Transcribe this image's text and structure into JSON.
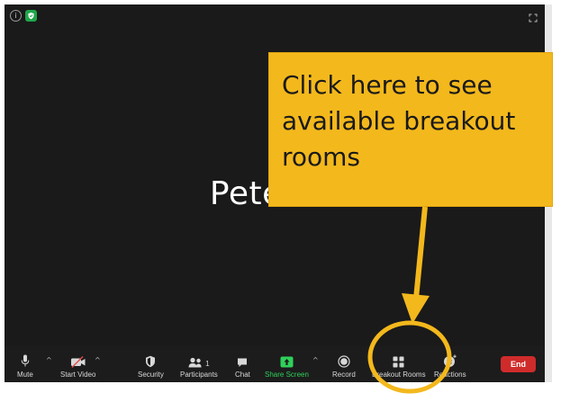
{
  "participant": {
    "name": "Peter W"
  },
  "toolbar": {
    "mute": "Mute",
    "start_video": "Start Video",
    "security": "Security",
    "participants": "Participants",
    "participant_count": "1",
    "chat": "Chat",
    "share_screen": "Share Screen",
    "record": "Record",
    "breakout_rooms": "Breakout Rooms",
    "reactions": "Reactions",
    "end": "End"
  },
  "callout": {
    "text": "Click here to see available breakout rooms",
    "color": "#f3b81c"
  },
  "colors": {
    "end_button": "#cf2b2b",
    "share_screen": "#2fd05a",
    "security_badge": "#1fa64a",
    "highlight_circle": "#f3b81c"
  },
  "icons": [
    "info-icon",
    "shield-check-icon",
    "fullscreen-icon",
    "microphone-icon",
    "video-off-icon",
    "shield-icon",
    "participants-icon",
    "chat-icon",
    "share-screen-icon",
    "record-icon",
    "breakout-rooms-icon",
    "reactions-icon"
  ]
}
